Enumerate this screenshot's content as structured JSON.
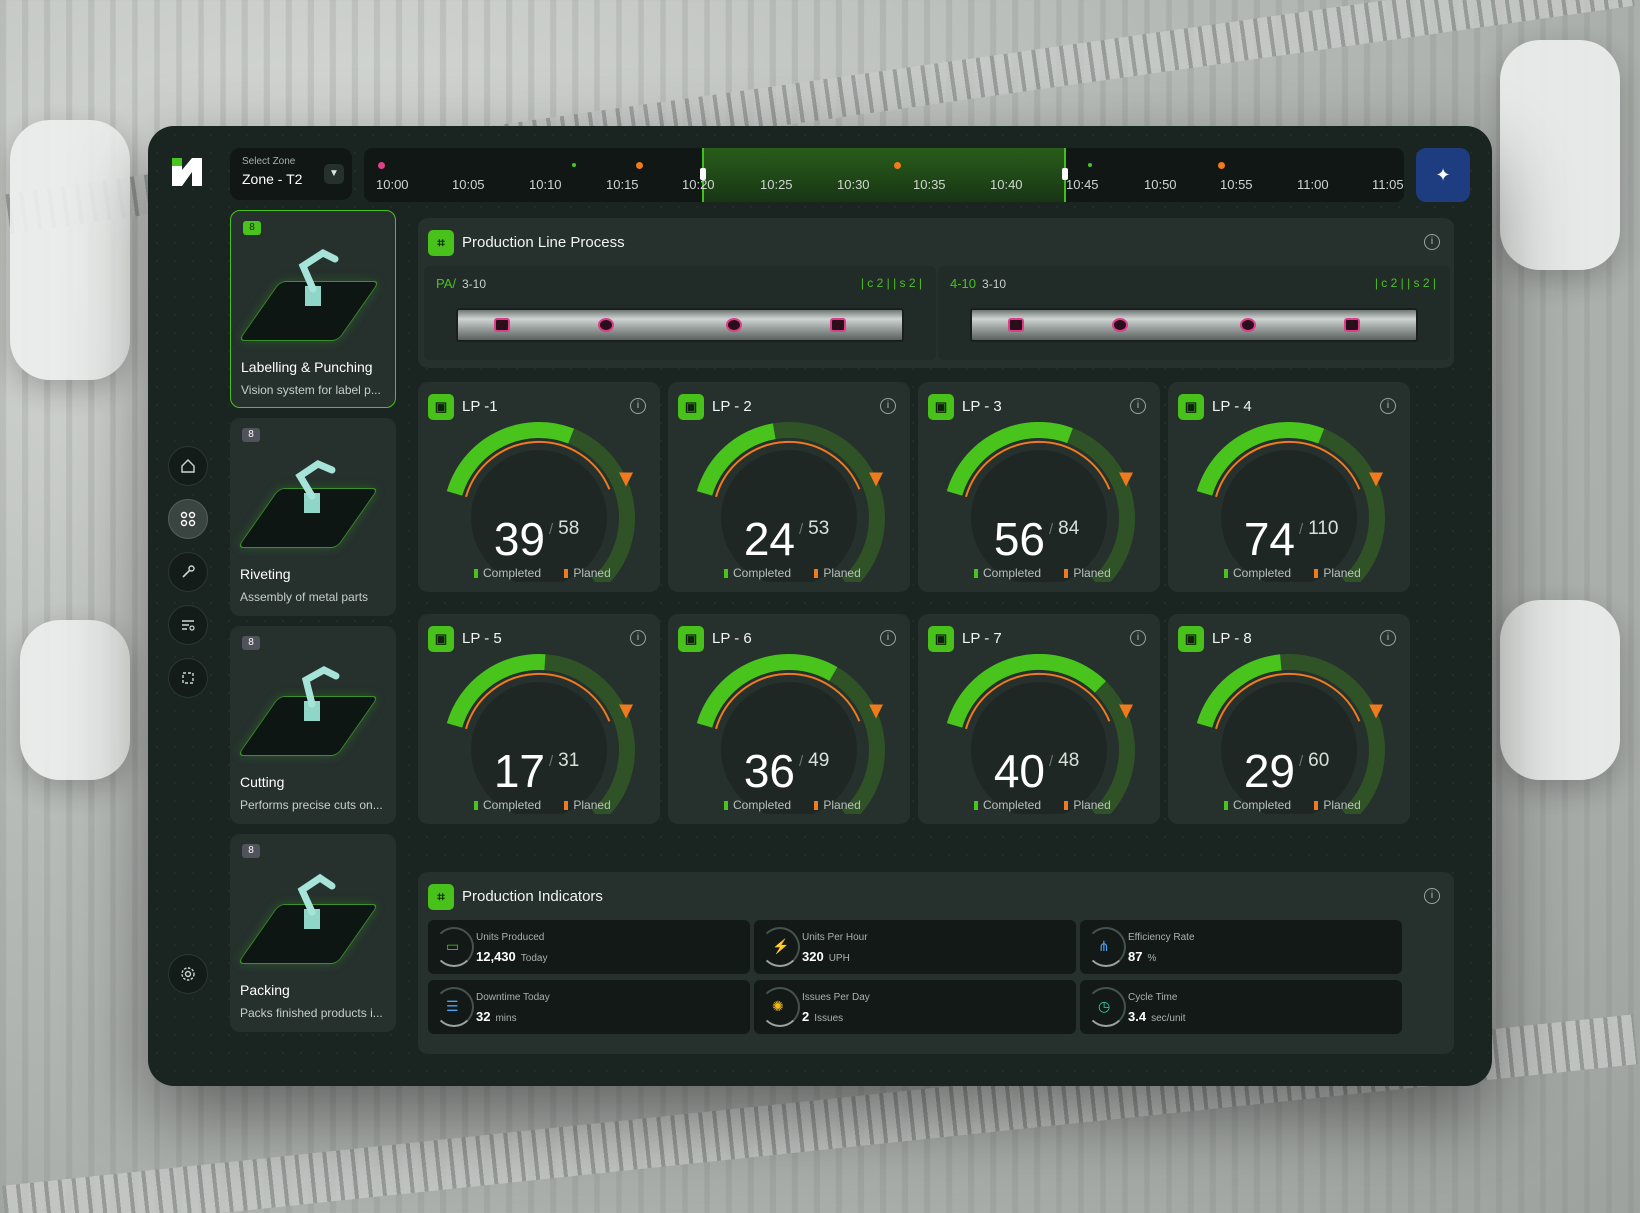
{
  "zone": {
    "label": "Select Zone",
    "value": "Zone - T2"
  },
  "timeline": {
    "ticks": [
      "10:00",
      "10:05",
      "10:10",
      "10:15",
      "10:20",
      "10:25",
      "10:30",
      "10:35",
      "10:40",
      "10:45",
      "10:50",
      "10:55",
      "11:00",
      "11:05"
    ],
    "selected_start": "10:20",
    "selected_end": "10:45"
  },
  "stations": [
    {
      "badge": "8",
      "title": "Labelling & Punching",
      "desc": "Vision system for label p...",
      "active": true
    },
    {
      "badge": "8",
      "title": "Riveting",
      "desc": "Assembly of metal parts",
      "active": false
    },
    {
      "badge": "8",
      "title": "Cutting",
      "desc": "Performs precise cuts on...",
      "active": false
    },
    {
      "badge": "8",
      "title": "Packing",
      "desc": "Packs finished products i...",
      "active": false
    }
  ],
  "process": {
    "title": "Production Line Process",
    "lanes": [
      {
        "code": "PA/",
        "range": "3-10",
        "c": "c 2",
        "s": "s 2"
      },
      {
        "code": "4-10",
        "range": "3-10",
        "c": "c 2",
        "s": "s 2"
      }
    ]
  },
  "gauge_legend": {
    "completed": "Completed",
    "planned": "Planed"
  },
  "lines": [
    {
      "name": "LP -1",
      "completed": 39,
      "planned": 58
    },
    {
      "name": "LP - 2",
      "completed": 24,
      "planned": 53
    },
    {
      "name": "LP - 3",
      "completed": 56,
      "planned": 84
    },
    {
      "name": "LP - 4",
      "completed": 74,
      "planned": 110
    },
    {
      "name": "LP - 5",
      "completed": 17,
      "planned": 31
    },
    {
      "name": "LP - 6",
      "completed": 36,
      "planned": 49
    },
    {
      "name": "LP - 7",
      "completed": 40,
      "planned": 48
    },
    {
      "name": "LP - 8",
      "completed": 29,
      "planned": 60
    }
  ],
  "indicators": {
    "title": "Production Indicators",
    "items": [
      {
        "label": "Units Produced",
        "value": "12,430",
        "unit": "Today",
        "icon": "battery-icon"
      },
      {
        "label": "Units Per Hour",
        "value": "320",
        "unit": "UPH",
        "icon": "speed-icon"
      },
      {
        "label": "Efficiency Rate",
        "value": "87",
        "unit": "%",
        "icon": "network-icon"
      },
      {
        "label": "Downtime Today",
        "value": "32",
        "unit": "mins",
        "icon": "list-icon"
      },
      {
        "label": "Issues Per Day",
        "value": "2",
        "unit": "Issues",
        "icon": "bug-icon"
      },
      {
        "label": "Cycle Time",
        "value": "3.4",
        "unit": "sec/unit",
        "icon": "timer-icon"
      }
    ]
  },
  "colors": {
    "green": "#49c41c",
    "track": "#2f5226",
    "orange": "#f07a1e",
    "panel": "#26302d"
  }
}
